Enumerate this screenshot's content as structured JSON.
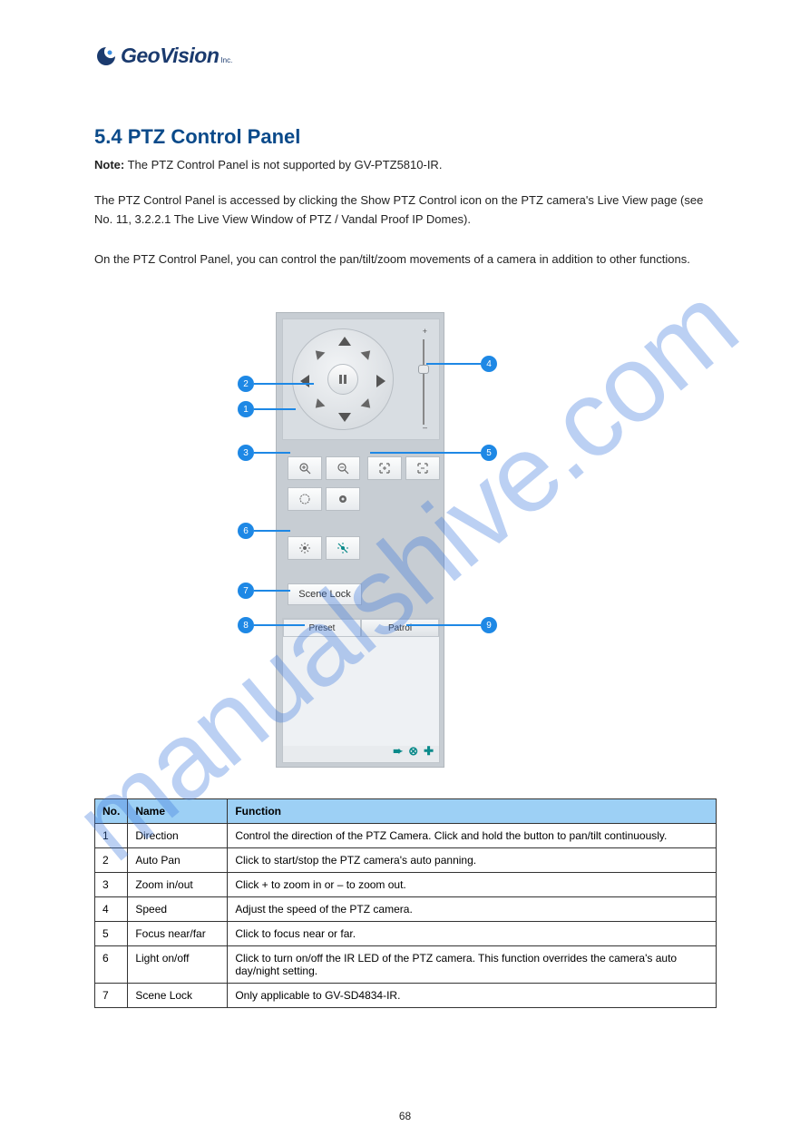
{
  "logo": {
    "brand": "GeoVision",
    "suffix": "Inc."
  },
  "heading": "5.4  PTZ Control Panel",
  "note_label": "Note:",
  "note_text": "The PTZ Control Panel is not supported by GV-PTZ5810-IR.",
  "intro_1": "The PTZ Control Panel is accessed by clicking the Show PTZ Control icon on the PTZ camera's Live View page (see No. 11, 3.2.2.1 The Live View Window of PTZ / Vandal Proof IP Domes).",
  "intro_2": "On the PTZ Control Panel, you can control the pan/tilt/zoom movements of a camera in addition to other functions.",
  "panel": {
    "scene_lock": "Scene Lock",
    "tab_preset": "Preset",
    "tab_patrol": "Patrol",
    "slider_plus": "+",
    "slider_minus": "–"
  },
  "callouts": {
    "c1": "1",
    "c2": "2",
    "c3": "3",
    "c4": "4",
    "c5": "5",
    "c6": "6",
    "c7": "7",
    "c8": "8",
    "c9": "9"
  },
  "table": {
    "headers": {
      "no": "No.",
      "name": "Name",
      "function": "Function"
    },
    "rows": [
      {
        "no": "1",
        "name": "Direction",
        "function": "Control the direction of the PTZ Camera. Click and hold the button to pan/tilt continuously."
      },
      {
        "no": "2",
        "name": "Auto Pan",
        "function": "Click to start/stop the PTZ camera's auto panning."
      },
      {
        "no": "3",
        "name": "Zoom in/out",
        "function": "Click + to zoom in or – to zoom out."
      },
      {
        "no": "4",
        "name": "Speed",
        "function": "Adjust the speed of the PTZ camera."
      },
      {
        "no": "5",
        "name": "Focus near/far",
        "function": "Click to focus near or far."
      },
      {
        "no": "6",
        "name": "Light on/off",
        "function": "Click to turn on/off the IR LED of the PTZ camera. This function overrides the camera's auto day/night setting."
      },
      {
        "no": "7",
        "name": "Scene Lock",
        "function": "Only applicable to GV-SD4834-IR."
      }
    ]
  },
  "page_number": "68"
}
